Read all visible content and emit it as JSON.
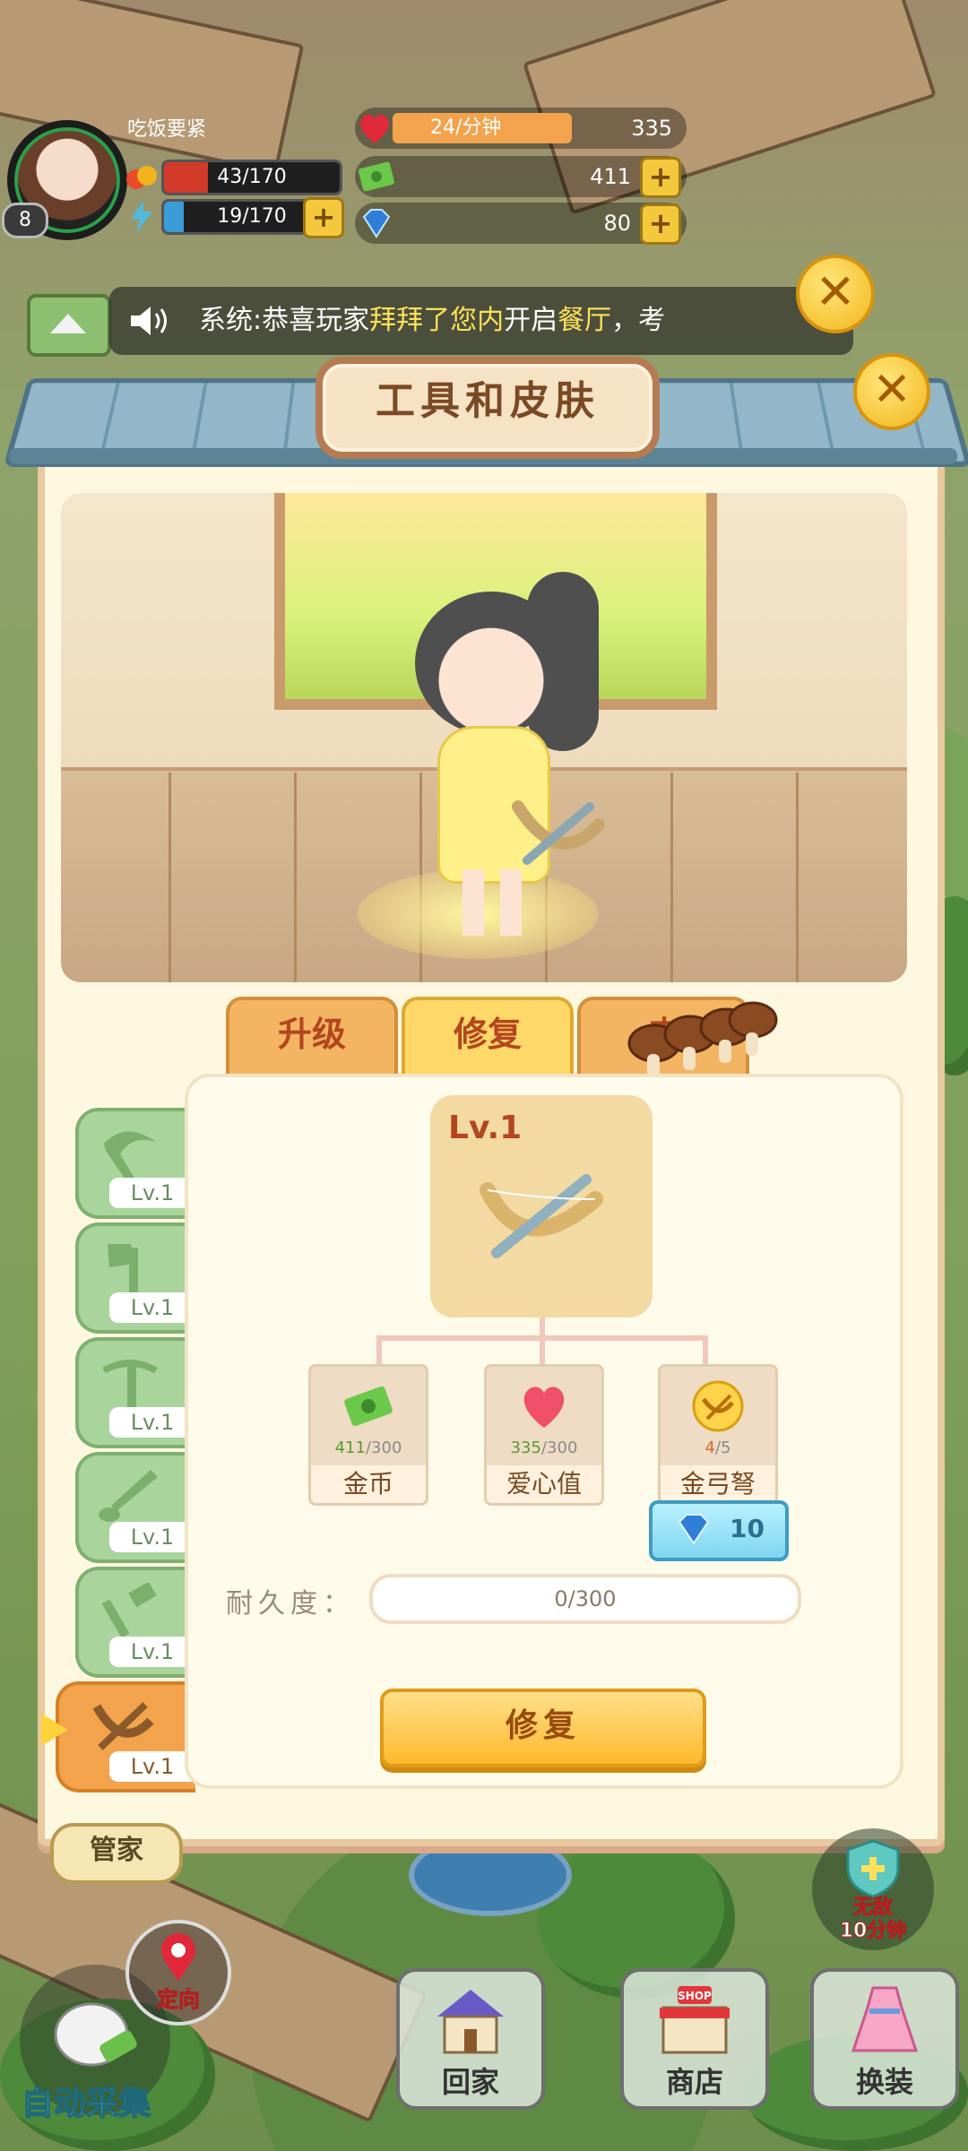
{
  "hud": {
    "player_name": "吃饭要紧",
    "player_level": "8",
    "stamina": "43/170",
    "stamina_fraction": 0.25,
    "energy": "19/170",
    "energy_fraction": 0.11,
    "love_rate": "24/分钟",
    "love_value": "335",
    "cash": "411",
    "diamonds": "80",
    "plus": "+"
  },
  "system_message": {
    "prefix": "系统:恭喜玩家",
    "player": "拜拜了您内",
    "middle": "开启",
    "place": "餐厅",
    "suffix": "，考"
  },
  "panel": {
    "title": "工具和皮肤",
    "close": "✕",
    "tabs": [
      {
        "label": "升级",
        "active": false
      },
      {
        "label": "修复",
        "active": true
      },
      {
        "label": "皮",
        "active": false
      }
    ]
  },
  "tools": [
    {
      "icon": "sickle-icon",
      "lv": "Lv.1"
    },
    {
      "icon": "axe-icon",
      "lv": "Lv.1"
    },
    {
      "icon": "pickaxe-icon",
      "lv": "Lv.1"
    },
    {
      "icon": "shovel-icon",
      "lv": "Lv.1"
    },
    {
      "icon": "hammer-icon",
      "lv": "Lv.1"
    },
    {
      "icon": "crossbow-icon",
      "lv": "Lv.1",
      "selected": true
    }
  ],
  "item": {
    "level": "Lv.1",
    "icon": "crossbow-icon"
  },
  "materials": [
    {
      "icon": "cash-icon",
      "have": "411",
      "need": "/300",
      "name": "金币"
    },
    {
      "icon": "heart-icon",
      "have": "335",
      "need": "/300",
      "name": "爱心值"
    },
    {
      "icon": "gold-crossbow-icon",
      "have": "4",
      "need": "/5",
      "name": "金弓弩"
    }
  ],
  "diamond_cost": "10",
  "durability": {
    "label": "耐久度：",
    "value": "0/300",
    "fraction": 0
  },
  "repair_button": "修复",
  "bottom": {
    "steward": "管家",
    "invincible_line1": "无敌",
    "invincible_line2": "10分钟",
    "locate": "定向",
    "auto_collect": "自动采集",
    "nav": [
      "回家",
      "商店",
      "换装"
    ],
    "shop_sign": "SHOP"
  },
  "colors": {
    "accent_orange": "#f2a34c",
    "tab_active": "#ffd86a",
    "slot_green": "#a9d49c",
    "title_brown": "#7a4a24",
    "highlight_yellow": "#ffe05a"
  }
}
